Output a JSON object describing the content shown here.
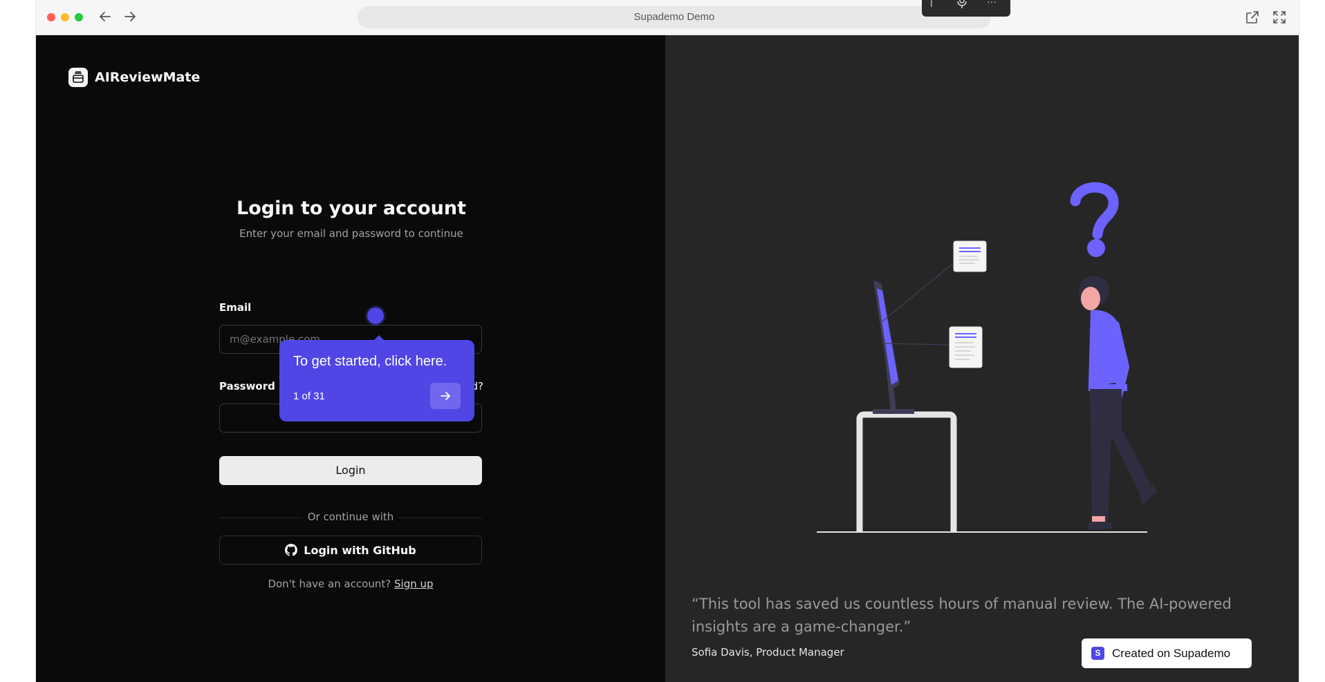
{
  "browser": {
    "url_title": "Supademo Demo"
  },
  "brand": {
    "name": "AIReviewMate"
  },
  "login": {
    "title": "Login to your account",
    "subtitle": "Enter your email and password to continue",
    "email_label": "Email",
    "email_placeholder": "m@example.com",
    "password_label": "Password",
    "forgot_label": "d?",
    "login_button": "Login",
    "divider_text": "Or continue with",
    "github_button": "Login with GitHub",
    "signup_prompt": "Don't have an account?",
    "signup_link": "Sign up"
  },
  "tour": {
    "tooltip_text": "To get started, click here.",
    "step_counter": "1 of 31",
    "accent": "#4f46e5"
  },
  "testimonial": {
    "quote": "“This tool has saved us countless hours of manual review. The AI-powered insights are a game-changer.”",
    "author": "Sofia Davis, Product Manager"
  },
  "badge": {
    "label": "Created on Supademo",
    "logo": "S"
  },
  "colors": {
    "left_bg": "#0a0a0a",
    "right_bg": "#262626",
    "illustration_accent": "#6c63ff"
  }
}
